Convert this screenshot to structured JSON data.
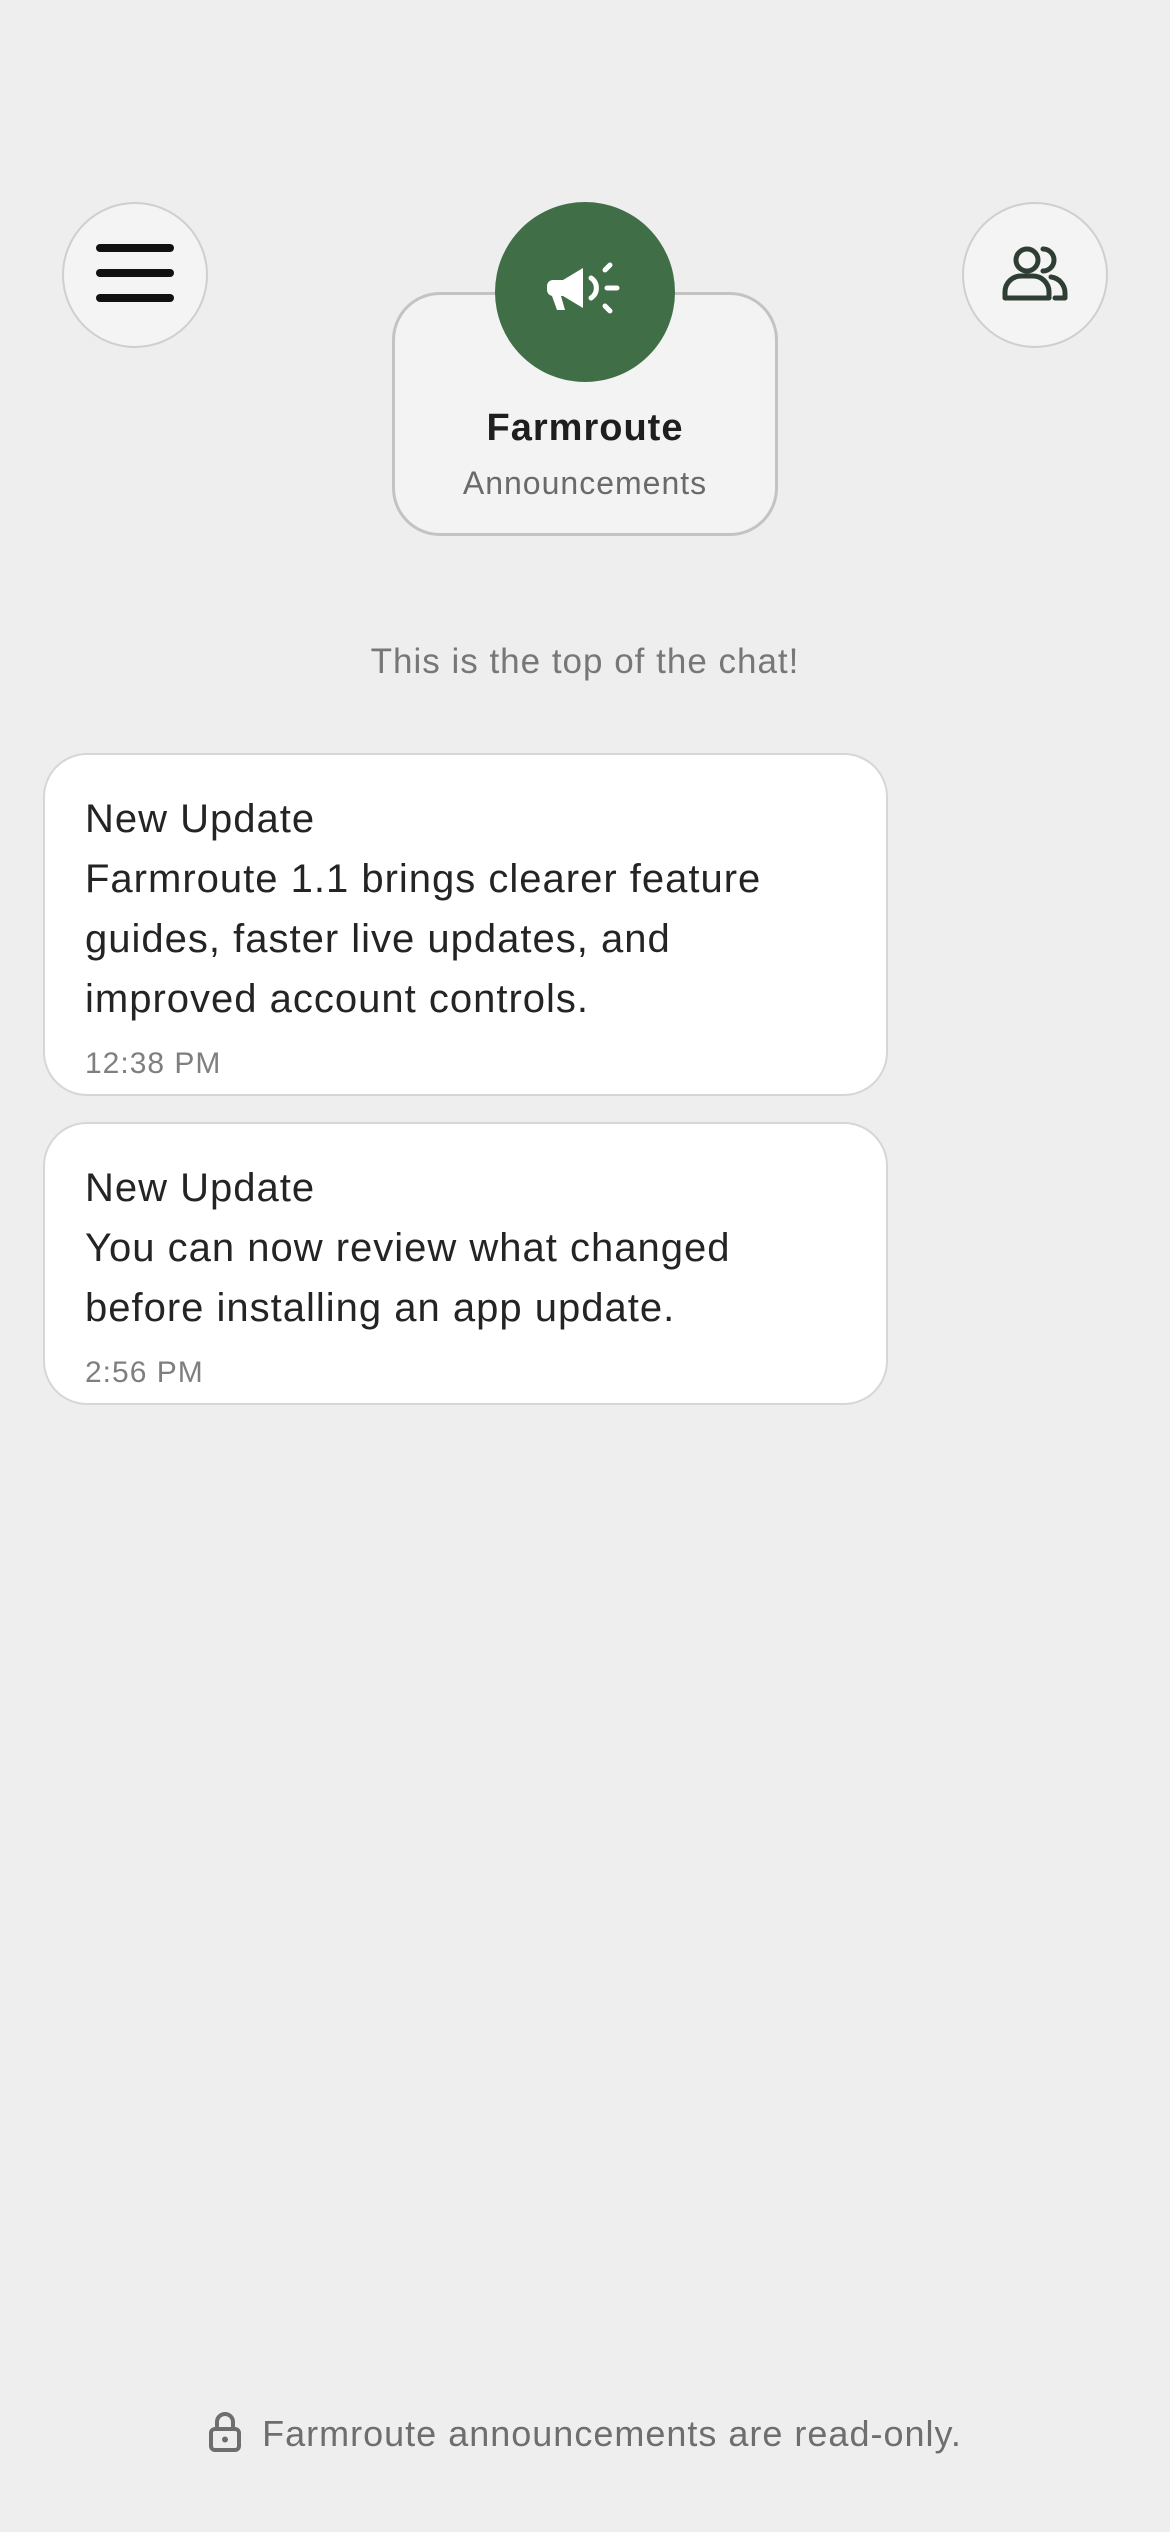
{
  "header": {
    "menu_icon": "hamburger-menu-icon",
    "members_icon": "users-icon",
    "channel": {
      "icon": "megaphone-icon",
      "name": "Farmroute",
      "subtitle": "Announcements",
      "accent_color": "#3f6e47"
    }
  },
  "chat": {
    "top_note": "This is the top of the chat!",
    "messages": [
      {
        "title": "New Update",
        "body": "Farmroute 1.1 brings clearer feature guides, faster live updates, and improved account controls.",
        "time": "12:38 PM"
      },
      {
        "title": "New Update",
        "body": "You can now review what changed before installing an app update.",
        "time": "2:56 PM"
      }
    ]
  },
  "footer": {
    "icon": "lock-icon",
    "text": "Farmroute announcements are read-only."
  }
}
